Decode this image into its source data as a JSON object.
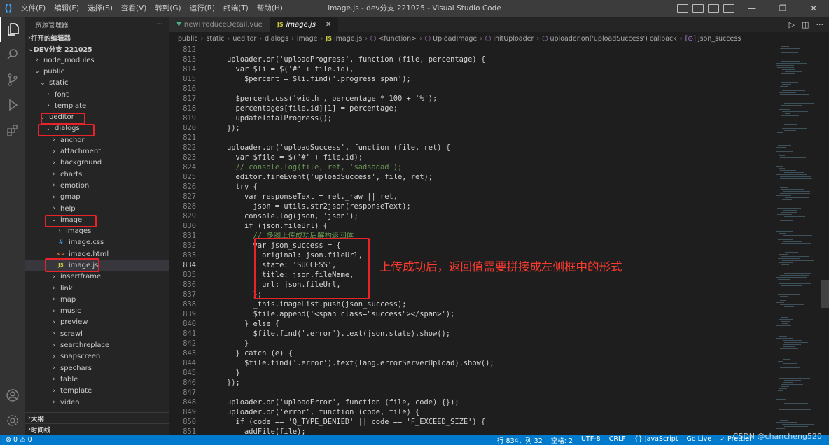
{
  "titlebar": {
    "menu": [
      "文件(F)",
      "编辑(E)",
      "选择(S)",
      "查看(V)",
      "转到(G)",
      "运行(R)",
      "终端(T)",
      "帮助(H)"
    ],
    "title": "image.js - dev分支 221025 - Visual Studio Code"
  },
  "sidebar": {
    "header": "资源管理器",
    "open_editors": "打开的编辑器",
    "project": "DEV分支 221025",
    "tree": [
      {
        "label": "node_modules",
        "indent": 1,
        "type": "folder",
        "open": false
      },
      {
        "label": "public",
        "indent": 1,
        "type": "folder",
        "open": true
      },
      {
        "label": "static",
        "indent": 2,
        "type": "folder",
        "open": true
      },
      {
        "label": "font",
        "indent": 3,
        "type": "folder",
        "open": false
      },
      {
        "label": "template",
        "indent": 3,
        "type": "folder",
        "open": false
      },
      {
        "label": "ueditor",
        "indent": 2,
        "type": "folder",
        "open": true
      },
      {
        "label": "dialogs",
        "indent": 3,
        "type": "folder",
        "open": true
      },
      {
        "label": "anchor",
        "indent": 4,
        "type": "folder",
        "open": false
      },
      {
        "label": "attachment",
        "indent": 4,
        "type": "folder",
        "open": false
      },
      {
        "label": "background",
        "indent": 4,
        "type": "folder",
        "open": false
      },
      {
        "label": "charts",
        "indent": 4,
        "type": "folder",
        "open": false
      },
      {
        "label": "emotion",
        "indent": 4,
        "type": "folder",
        "open": false
      },
      {
        "label": "gmap",
        "indent": 4,
        "type": "folder",
        "open": false
      },
      {
        "label": "help",
        "indent": 4,
        "type": "folder",
        "open": false
      },
      {
        "label": "image",
        "indent": 4,
        "type": "folder",
        "open": true
      },
      {
        "label": "images",
        "indent": 5,
        "type": "folder",
        "open": false
      },
      {
        "label": "image.css",
        "indent": 5,
        "type": "css"
      },
      {
        "label": "image.html",
        "indent": 5,
        "type": "html"
      },
      {
        "label": "image.js",
        "indent": 5,
        "type": "js",
        "selected": true
      },
      {
        "label": "insertframe",
        "indent": 4,
        "type": "folder",
        "open": false
      },
      {
        "label": "link",
        "indent": 4,
        "type": "folder",
        "open": false
      },
      {
        "label": "map",
        "indent": 4,
        "type": "folder",
        "open": false
      },
      {
        "label": "music",
        "indent": 4,
        "type": "folder",
        "open": false
      },
      {
        "label": "preview",
        "indent": 4,
        "type": "folder",
        "open": false
      },
      {
        "label": "scrawl",
        "indent": 4,
        "type": "folder",
        "open": false
      },
      {
        "label": "searchreplace",
        "indent": 4,
        "type": "folder",
        "open": false
      },
      {
        "label": "snapscreen",
        "indent": 4,
        "type": "folder",
        "open": false
      },
      {
        "label": "spechars",
        "indent": 4,
        "type": "folder",
        "open": false
      },
      {
        "label": "table",
        "indent": 4,
        "type": "folder",
        "open": false
      },
      {
        "label": "template",
        "indent": 4,
        "type": "folder",
        "open": false
      },
      {
        "label": "video",
        "indent": 4,
        "type": "folder",
        "open": false
      }
    ],
    "outline": "大纲",
    "timeline": "时间线"
  },
  "tabs": [
    {
      "label": "newProduceDetail.vue",
      "active": false
    },
    {
      "label": "image.js",
      "active": true
    }
  ],
  "breadcrumb": [
    "public",
    "static",
    "ueditor",
    "dialogs",
    "image",
    "image.js",
    "<function>",
    "UploadImage",
    "initUploader",
    "uploader.on('uploadSuccess') callback",
    "json_success"
  ],
  "code": {
    "current_line": 834,
    "lines": [
      {
        "n": 812,
        "t": ""
      },
      {
        "n": 813,
        "t": "    uploader.on('uploadProgress', function (file, percentage) {"
      },
      {
        "n": 814,
        "t": "      var $li = $('#' + file.id),"
      },
      {
        "n": 815,
        "t": "        $percent = $li.find('.progress span');"
      },
      {
        "n": 816,
        "t": ""
      },
      {
        "n": 817,
        "t": "      $percent.css('width', percentage * 100 + '%');"
      },
      {
        "n": 818,
        "t": "      percentages[file.id][1] = percentage;"
      },
      {
        "n": 819,
        "t": "      updateTotalProgress();"
      },
      {
        "n": 820,
        "t": "    });"
      },
      {
        "n": 821,
        "t": ""
      },
      {
        "n": 822,
        "t": "    uploader.on('uploadSuccess', function (file, ret) {"
      },
      {
        "n": 823,
        "t": "      var $file = $('#' + file.id);"
      },
      {
        "n": 824,
        "t": "      // console.log(file, ret, 'sadsadad');"
      },
      {
        "n": 825,
        "t": "      editor.fireEvent('uploadSuccess', file, ret);"
      },
      {
        "n": 826,
        "t": "      try {"
      },
      {
        "n": 827,
        "t": "        var responseText = ret._raw || ret,"
      },
      {
        "n": 828,
        "t": "          json = utils.str2json(responseText);"
      },
      {
        "n": 829,
        "t": "        console.log(json, 'json');"
      },
      {
        "n": 830,
        "t": "        if (json.fileUrl) {"
      },
      {
        "n": 831,
        "t": "          // 多图上传成功后解构返回体"
      },
      {
        "n": 832,
        "t": "          var json_success = {"
      },
      {
        "n": 833,
        "t": "            original: json.fileUrl,"
      },
      {
        "n": 834,
        "t": "            state: 'SUCCESS',"
      },
      {
        "n": 835,
        "t": "            title: json.fileName,"
      },
      {
        "n": 836,
        "t": "            url: json.fileUrl,"
      },
      {
        "n": 837,
        "t": "          };"
      },
      {
        "n": 838,
        "t": "          _this.imageList.push(json_success);"
      },
      {
        "n": 839,
        "t": "          $file.append('<span class=\"success\"></span>');"
      },
      {
        "n": 840,
        "t": "        } else {"
      },
      {
        "n": 841,
        "t": "          $file.find('.error').text(json.state).show();"
      },
      {
        "n": 842,
        "t": "        }"
      },
      {
        "n": 843,
        "t": "      } catch (e) {"
      },
      {
        "n": 844,
        "t": "        $file.find('.error').text(lang.errorServerUpload).show();"
      },
      {
        "n": 845,
        "t": "      }"
      },
      {
        "n": 846,
        "t": "    });"
      },
      {
        "n": 847,
        "t": ""
      },
      {
        "n": 848,
        "t": "    uploader.on('uploadError', function (file, code) {});"
      },
      {
        "n": 849,
        "t": "    uploader.on('error', function (code, file) {"
      },
      {
        "n": 850,
        "t": "      if (code == 'Q_TYPE_DENIED' || code == 'F_EXCEED_SIZE') {"
      },
      {
        "n": 851,
        "t": "        addFile(file);"
      }
    ]
  },
  "annotation": "上传成功后，返回值需要拼接成左侧框中的形式",
  "statusbar": {
    "errors": "⊗ 0 ⚠ 0",
    "position": "行 834，列 32",
    "spaces": "空格: 2",
    "encoding": "UTF-8",
    "eol": "CRLF",
    "language": "{} JavaScript",
    "golive": "Go Live",
    "prettier": "✓ Prettier"
  },
  "watermark": "CSDN @chancheng520",
  "colors": {
    "accent": "#007acc",
    "highlight_box": "#e8232a",
    "annotation": "#ff3b30"
  }
}
